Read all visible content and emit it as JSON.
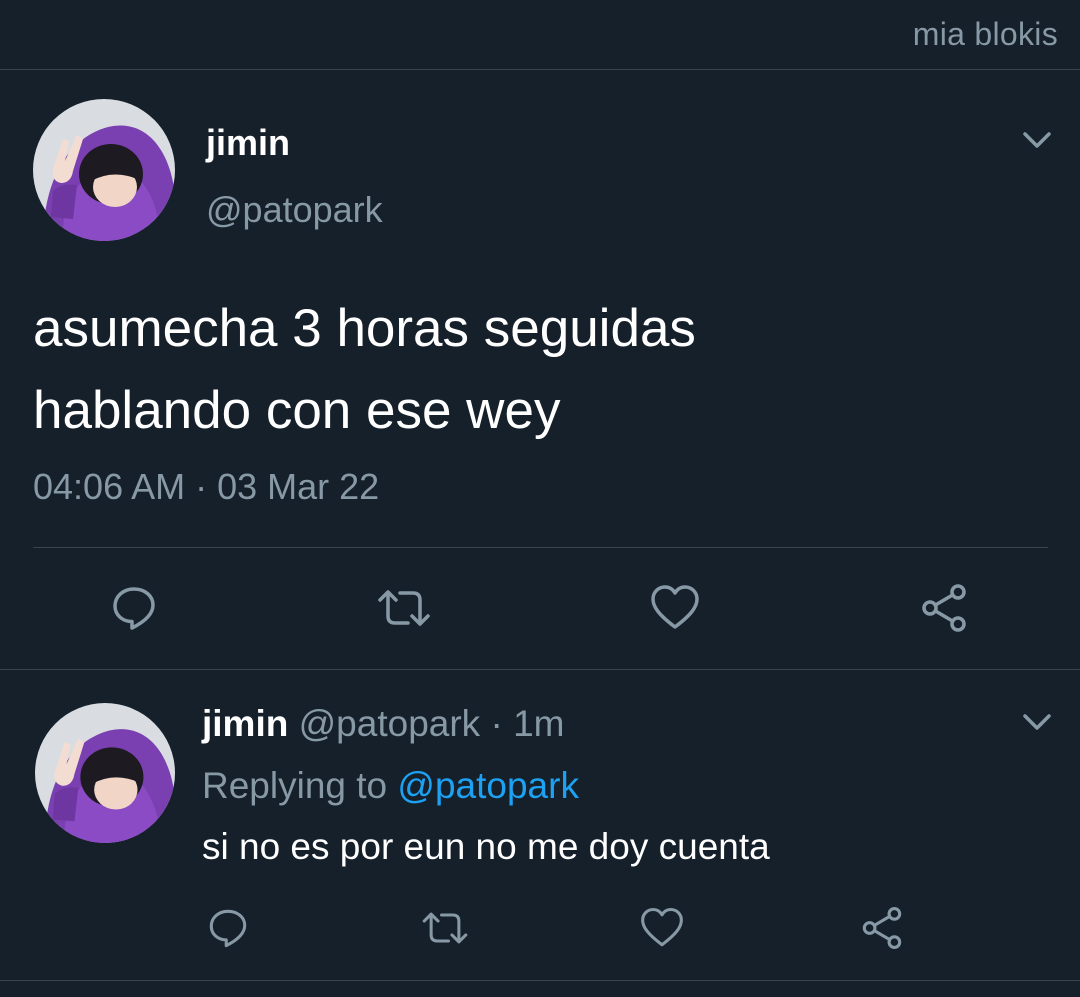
{
  "header": {
    "label": "mia blokis"
  },
  "main_tweet": {
    "name": "jimin",
    "handle": "@patopark",
    "text_line1": "asumecha 3 horas seguidas",
    "text_line2": "hablando con ese wey",
    "timestamp": "04:06 AM · 03 Mar 22",
    "actions": [
      "reply-icon",
      "retweet-icon",
      "like-icon",
      "share-icon"
    ]
  },
  "reply_tweet": {
    "name": "jimin",
    "handle": "@patopark",
    "separator": "·",
    "time": "1m",
    "replying_prefix": "Replying to",
    "replying_to": "@patopark",
    "text": "si no es por eun no me doy cuenta",
    "actions": [
      "reply-icon",
      "retweet-icon",
      "like-icon",
      "share-icon"
    ]
  },
  "colors": {
    "background": "#15202b",
    "divider": "#38444d",
    "secondary_text": "#8899a6",
    "link": "#1da1f2",
    "primary_text": "#ffffff"
  }
}
